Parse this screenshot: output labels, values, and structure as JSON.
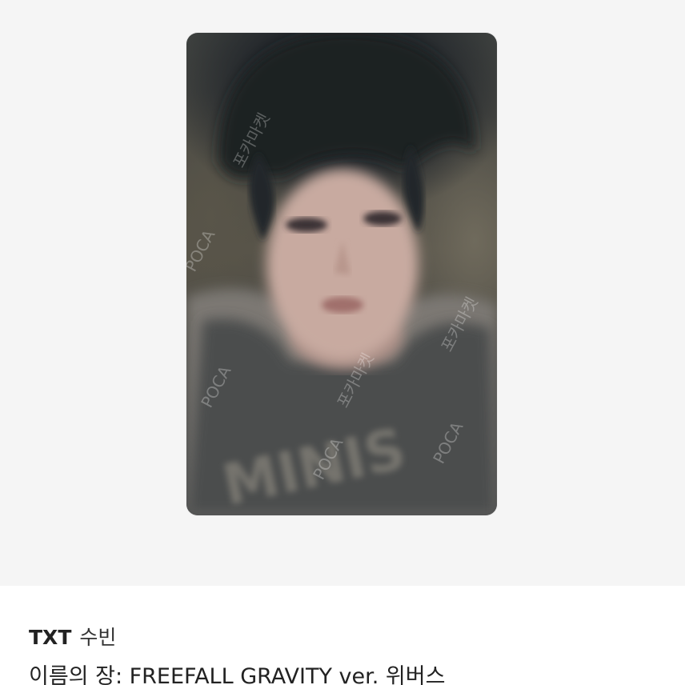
{
  "product": {
    "group": "TXT",
    "member": "수빈",
    "album_title": "이름의 장: FREEFALL GRAVITY ver. 위버스"
  },
  "photocard": {
    "shirt_text": "MINIS",
    "watermark_brand": "POCA",
    "watermark_kr": "포카마켓"
  },
  "colors": {
    "image_background": "#f5f5f5",
    "text": "#222222"
  }
}
